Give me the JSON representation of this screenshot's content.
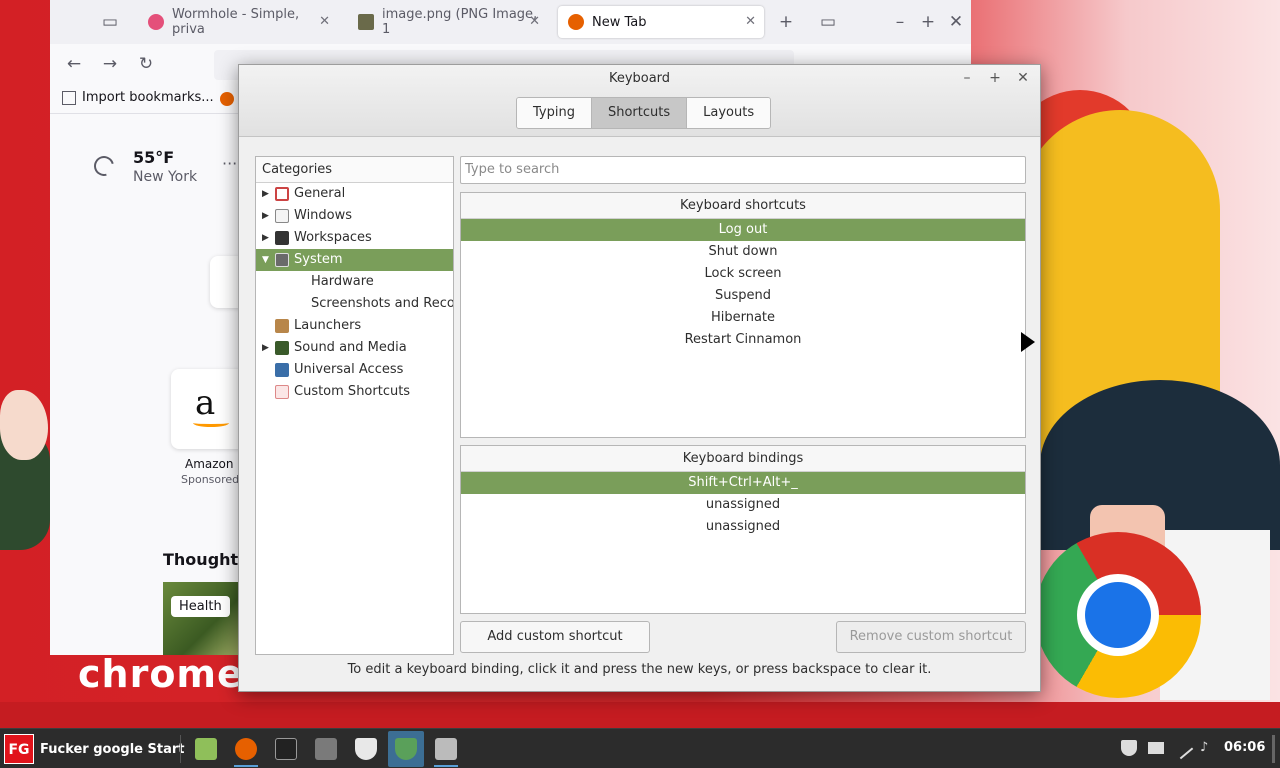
{
  "browser": {
    "tabs": [
      {
        "label": "Wormhole - Simple, priva",
        "favicon_color": "#e4507a"
      },
      {
        "label": "image.png (PNG Image, 1",
        "favicon_color": "#6a6a4a"
      },
      {
        "label": "New Tab",
        "favicon_color": "#e66000"
      }
    ],
    "bookmark_label": "Import bookmarks...",
    "weather": {
      "temp": "55°F",
      "city": "New York",
      "more": "···"
    },
    "tile": {
      "label": "Amazon",
      "sub": "Sponsored",
      "letter": "a"
    },
    "section_title": "Thought-",
    "story_tag": "Health"
  },
  "desktop": {
    "banner_text": "chrome s"
  },
  "dialog": {
    "title": "Keyboard",
    "tabs": [
      "Typing",
      "Shortcuts",
      "Layouts"
    ],
    "active_tab": "Shortcuts",
    "categories_header": "Categories",
    "categories": [
      {
        "label": "General",
        "arrow": "▶",
        "icon_color": "#c44"
      },
      {
        "label": "Windows",
        "arrow": "▶",
        "icon_color": "#dcdcdc"
      },
      {
        "label": "Workspaces",
        "arrow": "▶",
        "icon_color": "#333"
      },
      {
        "label": "System",
        "arrow": "▼",
        "icon_color": "#6a6a6a",
        "selected": true
      },
      {
        "label": "Hardware",
        "child": true
      },
      {
        "label": "Screenshots and Record",
        "child": true
      },
      {
        "label": "Launchers",
        "icon_color": "#b8864a"
      },
      {
        "label": "Sound and Media",
        "arrow": "▶",
        "icon_color": "#3a5a2a"
      },
      {
        "label": "Universal Access",
        "icon_color": "#3a6ea8"
      },
      {
        "label": "Custom Shortcuts",
        "icon_color": "#d88"
      }
    ],
    "search_placeholder": "Type to search",
    "shortcuts_header": "Keyboard shortcuts",
    "shortcuts": [
      "Log out",
      "Shut down",
      "Lock screen",
      "Suspend",
      "Hibernate",
      "Restart Cinnamon"
    ],
    "selected_shortcut": "Log out",
    "bindings_header": "Keyboard bindings",
    "bindings": [
      "Shift+Ctrl+Alt+_",
      "unassigned",
      "unassigned"
    ],
    "add_button": "Add custom shortcut",
    "remove_button": "Remove custom shortcut",
    "hint": "To edit a keyboard binding, click it and press the new keys, or press backspace to clear it."
  },
  "taskbar": {
    "menu_logo": "FG",
    "menu_label": "Fucker google Start",
    "clock": "06:06",
    "apps": [
      {
        "name": "files-icon",
        "color": "#8fbf5a"
      },
      {
        "name": "firefox-icon",
        "color": "#e66000"
      },
      {
        "name": "terminal-icon",
        "color": "#222"
      },
      {
        "name": "app-icon",
        "color": "#7a7a7a"
      },
      {
        "name": "shield-icon",
        "color": "#e8e8e8"
      },
      {
        "name": "update-manager-icon",
        "color": "#5aa05a"
      },
      {
        "name": "keyboard-icon",
        "color": "#bbbbbb"
      }
    ]
  },
  "colors": {
    "selection": "#7a9e5a",
    "taskbar": "#2c2c2c",
    "desktop_red": "#d32025"
  }
}
